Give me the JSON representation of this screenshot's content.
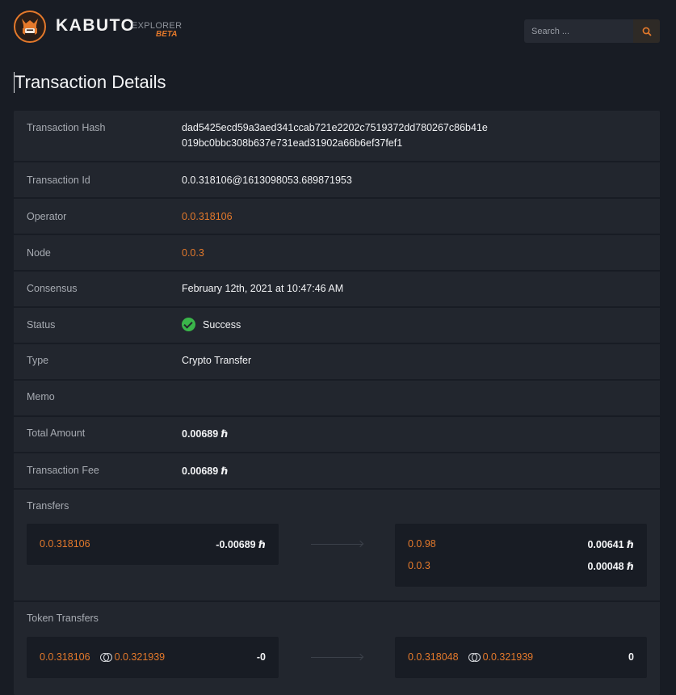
{
  "header": {
    "brand": "KABUTO",
    "explorer": "EXPLORER",
    "beta": "BETA",
    "search_placeholder": "Search ...",
    "accent_color": "#e4792b"
  },
  "page_title": "Transaction Details",
  "details": {
    "hash_label": "Transaction Hash",
    "hash_line1": "dad5425ecd59a3aed341ccab721e2202c7519372dd780267c86b41e",
    "hash_line2": "019bc0bbc308b637e731ead31902a66b6ef37fef1",
    "id_label": "Transaction Id",
    "id_value": "0.0.318106@1613098053.689871953",
    "operator_label": "Operator",
    "operator_value": "0.0.318106",
    "node_label": "Node",
    "node_value": "0.0.3",
    "consensus_label": "Consensus",
    "consensus_value": "February 12th, 2021 at 10:47:46 AM",
    "status_label": "Status",
    "status_value": "Success",
    "type_label": "Type",
    "type_value": "Crypto Transfer",
    "memo_label": "Memo",
    "memo_value": "",
    "total_label": "Total Amount",
    "total_value": "0.00689 ℏ",
    "fee_label": "Transaction Fee",
    "fee_value": "0.00689 ℏ"
  },
  "transfers": {
    "label": "Transfers",
    "from": {
      "account": "0.0.318106",
      "amount": "-0.00689 ℏ"
    },
    "to": [
      {
        "account": "0.0.98",
        "amount": "0.00641 ℏ"
      },
      {
        "account": "0.0.3",
        "amount": "0.00048 ℏ"
      }
    ]
  },
  "token_transfers": {
    "label": "Token Transfers",
    "from": {
      "account": "0.0.318106",
      "token": "0.0.321939",
      "amount": "-0"
    },
    "to": {
      "account": "0.0.318048",
      "token": "0.0.321939",
      "amount": "0"
    }
  }
}
